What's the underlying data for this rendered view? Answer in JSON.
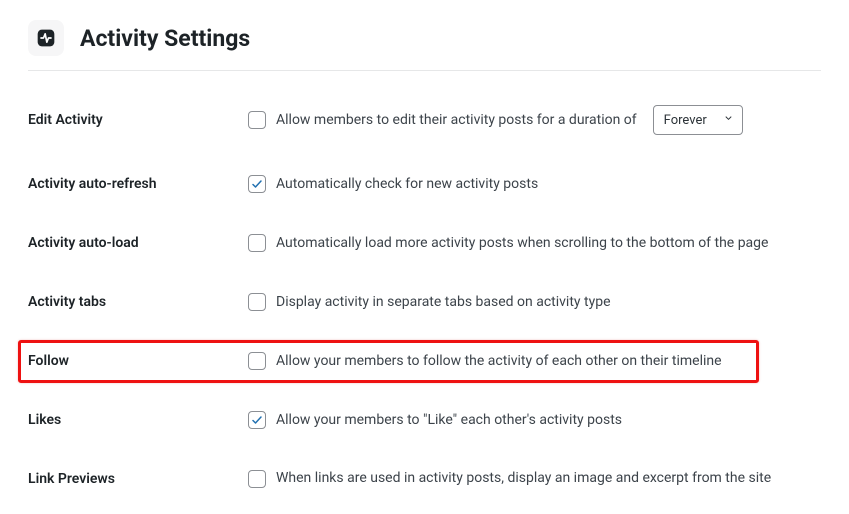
{
  "header": {
    "title": "Activity Settings"
  },
  "settings": {
    "edit_activity": {
      "label": "Edit Activity",
      "desc_before": "Allow members to edit their activity posts for a duration of",
      "checked": false,
      "select_value": "Forever"
    },
    "auto_refresh": {
      "label": "Activity auto-refresh",
      "desc": "Automatically check for new activity posts",
      "checked": true
    },
    "auto_load": {
      "label": "Activity auto-load",
      "desc": "Automatically load more activity posts when scrolling to the bottom of the page",
      "checked": false
    },
    "tabs": {
      "label": "Activity tabs",
      "desc": "Display activity in separate tabs based on activity type",
      "checked": false
    },
    "follow": {
      "label": "Follow",
      "desc": "Allow your members to follow the activity of each other on their timeline",
      "checked": false
    },
    "likes": {
      "label": "Likes",
      "desc": "Allow your members to \"Like\" each other's activity posts",
      "checked": true
    },
    "link_previews": {
      "label": "Link Previews",
      "desc": "When links are used in activity posts, display an image and excerpt from the site",
      "checked": false
    }
  }
}
